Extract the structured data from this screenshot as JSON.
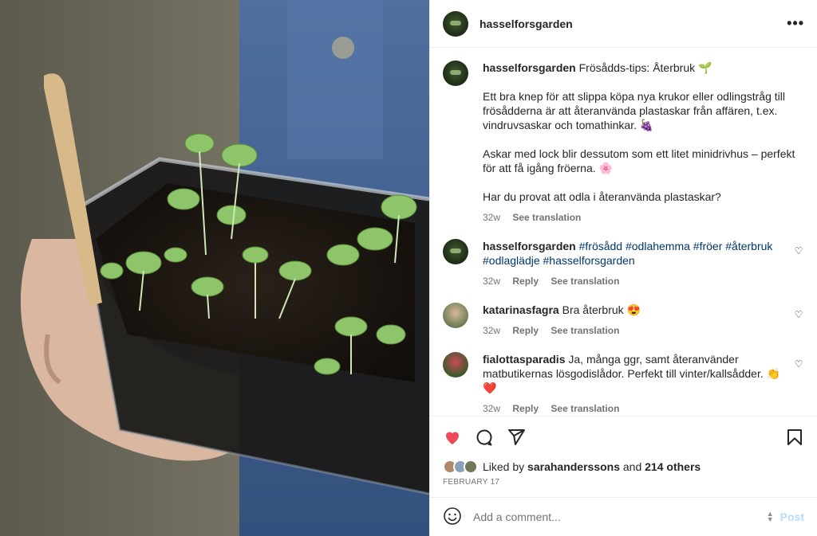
{
  "post": {
    "username": "hasselforsgarden",
    "caption_title": "Frösådds-tips: Återbruk 🌱",
    "caption_p1": "Ett bra knep för att slippa köpa nya krukor eller odlingstråg till frösådderna är att återanvända plastaskar från affären, t.ex. vindruvsaskar och tomathinkar. 🍇",
    "caption_p2": "Askar med lock blir dessutom som ett litet minidrivhus – perfekt för att få igång fröerna. 🌸",
    "caption_p3": "Har du provat att odla i återanvända plastaskar?",
    "caption_time": "32w",
    "see_translation": "See translation"
  },
  "comments": [
    {
      "username": "hasselforsgarden",
      "text": "#frösådd #odlahemma #fröer #återbruk #odlaglädje #hasselforsgarden",
      "time": "32w",
      "reply": "Reply",
      "translation": "See translation"
    },
    {
      "username": "katarinasfagra",
      "text": "Bra återbruk 😍",
      "time": "32w",
      "reply": "Reply",
      "translation": "See translation"
    },
    {
      "username": "fialottasparadis",
      "text": "Ja, många ggr, samt återanvänder matbutikernas lösgodislådor. Perfekt till vinter/kallsådder. 👏 ❤️",
      "time": "32w",
      "reply": "Reply",
      "translation": "See translation"
    }
  ],
  "likes": {
    "prefix": "Liked by",
    "user": "sarahanderssons",
    "and": "and",
    "others": "214 others"
  },
  "date": "FEBRUARY 17",
  "add_comment": {
    "placeholder": "Add a comment...",
    "post_label": "Post"
  },
  "colors": {
    "like_red": "#ed4956",
    "link": "#00376b",
    "post_disabled": "#b3dbff"
  },
  "icons": [
    "more-icon",
    "heart-icon",
    "comment-icon",
    "share-icon",
    "bookmark-icon",
    "emoji-icon"
  ]
}
